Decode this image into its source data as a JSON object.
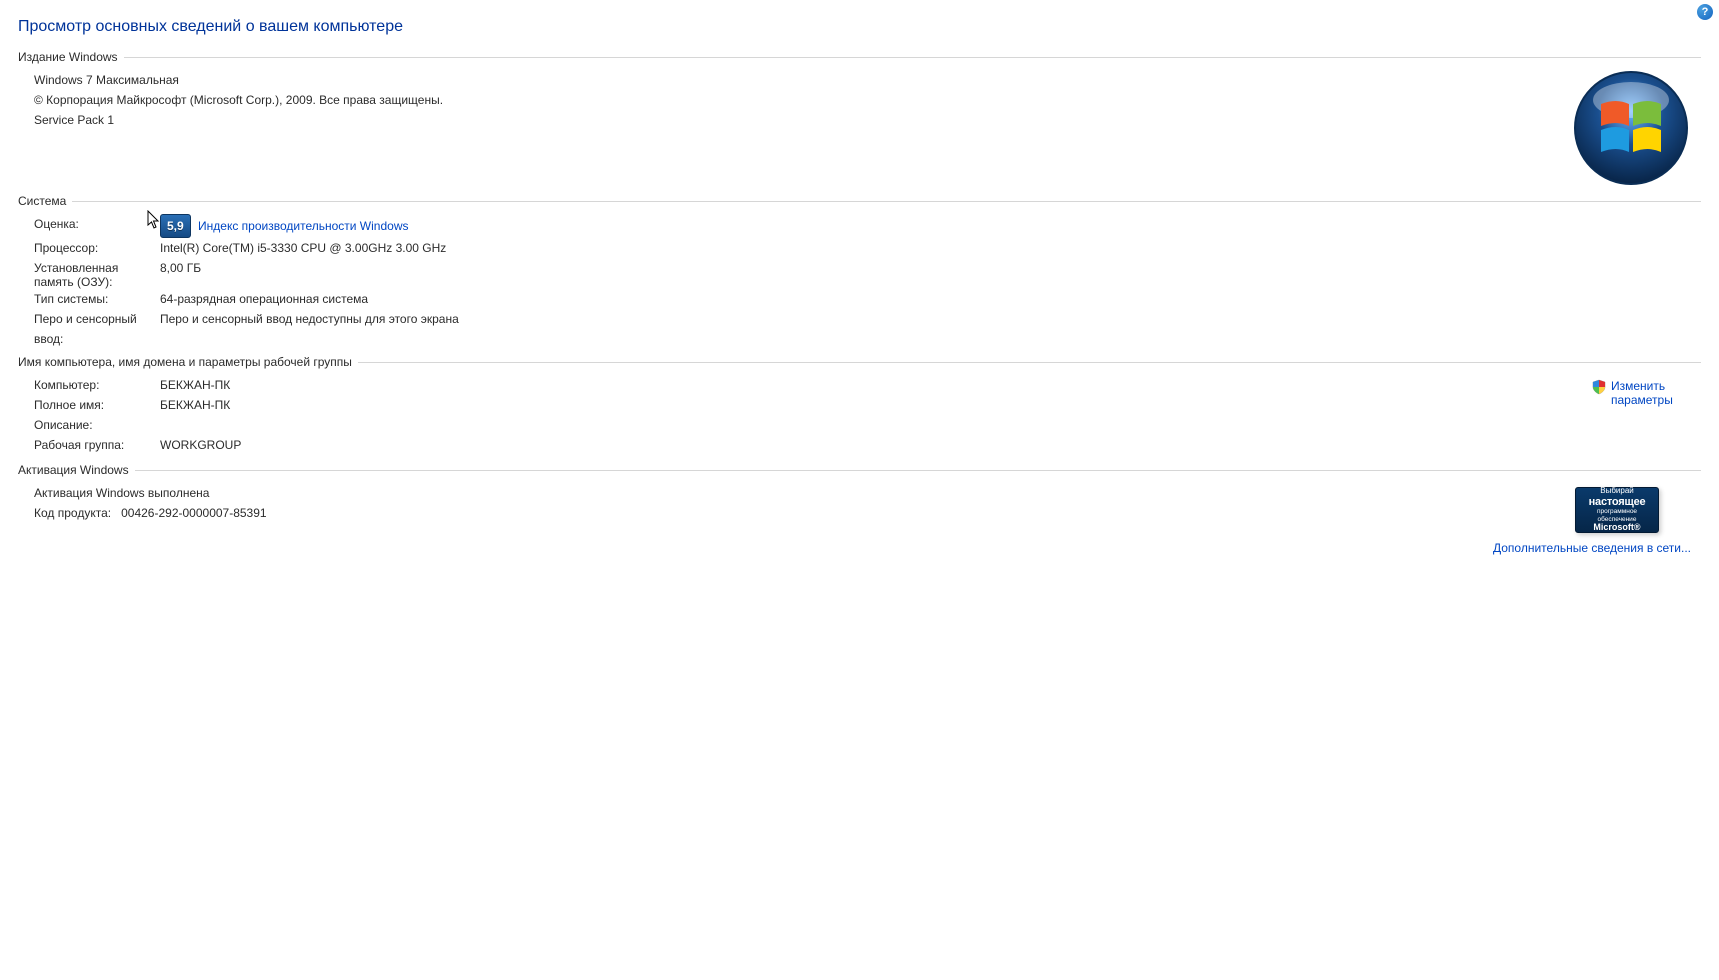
{
  "help_glyph": "?",
  "page_title": "Просмотр основных сведений о вашем компьютере",
  "edition": {
    "header": "Издание Windows",
    "name": "Windows 7 Максимальная",
    "copyright": "© Корпорация Майкрософт (Microsoft Corp.), 2009. Все права защищены.",
    "service_pack": "Service Pack 1"
  },
  "system": {
    "header": "Система",
    "rating_label": "Оценка:",
    "rating_value": "5,9",
    "rating_link": "Индекс производительности Windows",
    "cpu_label": "Процессор:",
    "cpu_value": "Intel(R) Core(TM) i5-3330 CPU @ 3.00GHz   3.00 GHz",
    "ram_label": "Установленная память (ОЗУ):",
    "ram_value": "8,00 ГБ",
    "type_label": "Тип системы:",
    "type_value": "64-разрядная операционная система",
    "pen_label": "Перо и сенсорный ввод:",
    "pen_value": "Перо и сенсорный ввод недоступны для этого экрана"
  },
  "naming": {
    "header": "Имя компьютера, имя домена и параметры рабочей группы",
    "computer_label": "Компьютер:",
    "computer_value": "БЕКЖАН-ПК",
    "fullname_label": "Полное имя:",
    "fullname_value": "БЕКЖАН-ПК",
    "description_label": "Описание:",
    "description_value": "",
    "workgroup_label": "Рабочая группа:",
    "workgroup_value": "WORKGROUP",
    "change_link": "Изменить параметры"
  },
  "activation": {
    "header": "Активация Windows",
    "status": "Активация Windows выполнена",
    "pid_label": "Код продукта:",
    "pid_value": "00426-292-0000007-85391",
    "genuine": {
      "line1": "Выбирай",
      "line2": "настоящее",
      "line3": "программное обеспечение",
      "line4": "Microsoft®"
    },
    "online_link": "Дополнительные сведения в сети..."
  }
}
